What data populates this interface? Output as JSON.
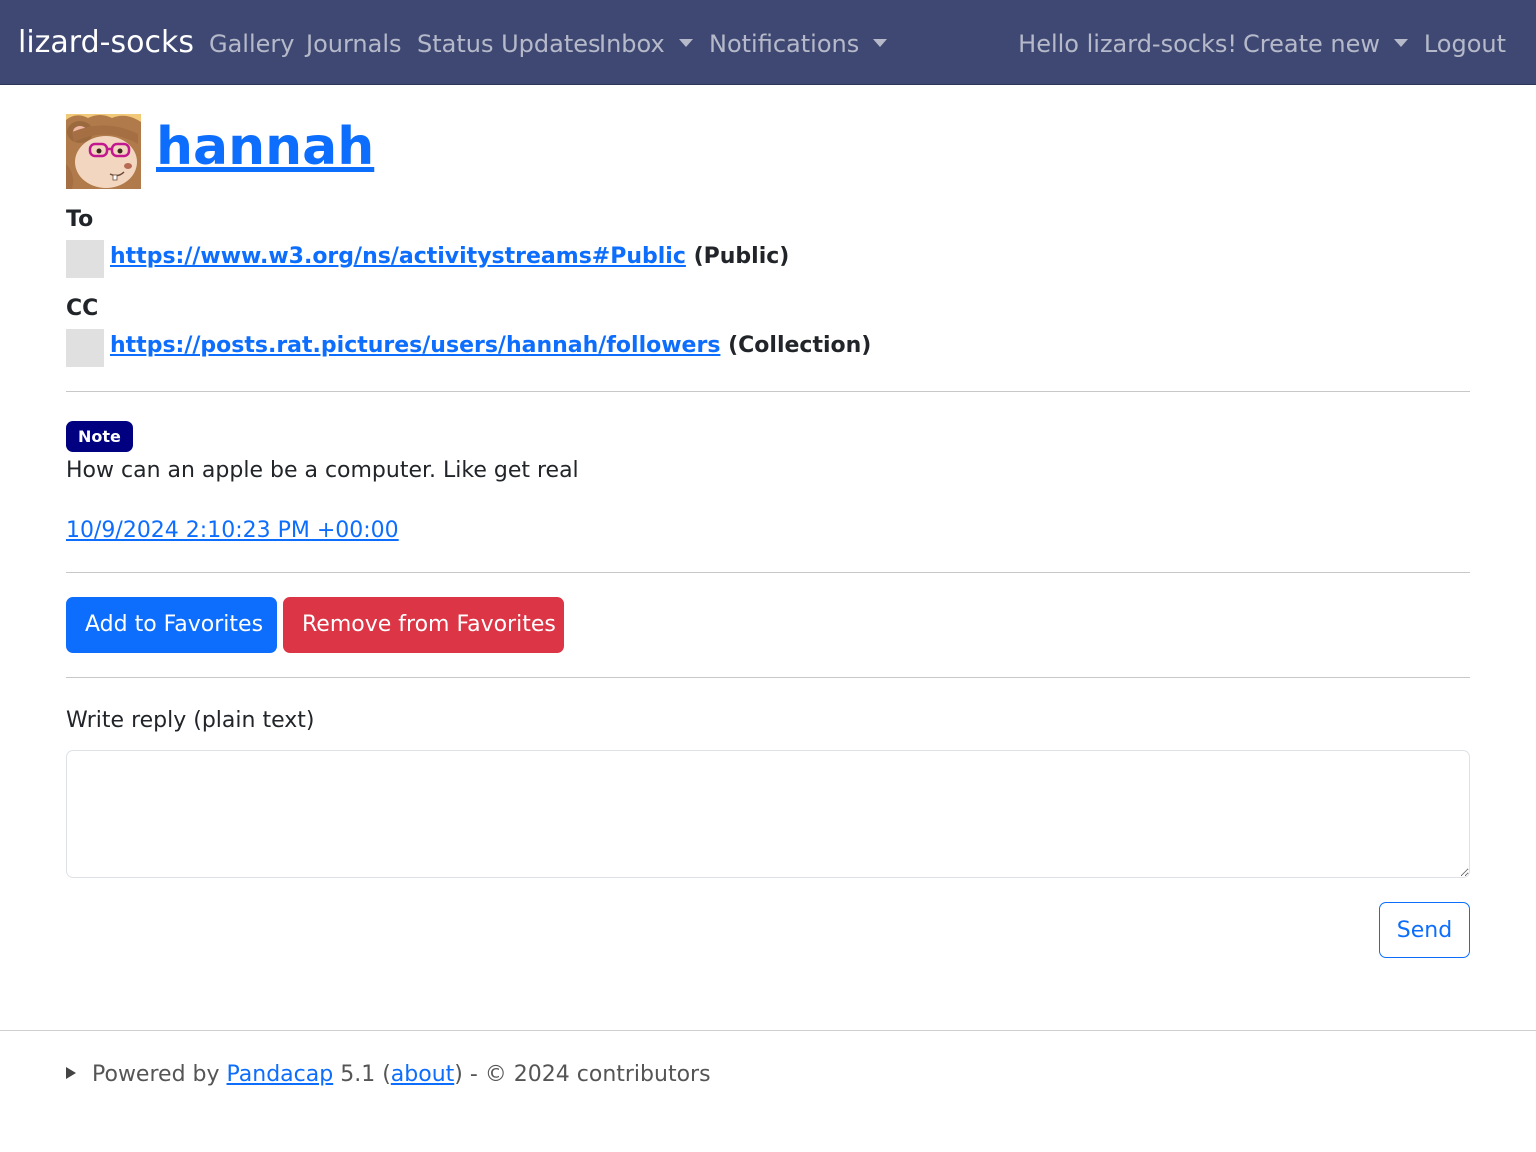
{
  "navbar": {
    "brand": "lizard-socks",
    "links": {
      "gallery": "Gallery",
      "journals": "Journals",
      "status_updates": "Status Updates",
      "inbox": "Inbox",
      "notifications": "Notifications"
    },
    "greeting": "Hello lizard-socks!",
    "create_new": "Create new",
    "logout": "Logout",
    "dropdown_icon": "caret-down-icon",
    "colors": {
      "background": "#3e4872",
      "text": "#ffffff",
      "muted_text": "rgba(255,255,255,0.62)"
    }
  },
  "post": {
    "author": {
      "name": "hannah",
      "avatar_icon": "rat-avatar-icon"
    },
    "to": {
      "label": "To",
      "recipients": [
        {
          "url": "https://www.w3.org/ns/activitystreams#Public",
          "kind": "(Public)"
        }
      ]
    },
    "cc": {
      "label": "CC",
      "recipients": [
        {
          "url": "https://posts.rat.pictures/users/hannah/followers",
          "kind": "(Collection)"
        }
      ]
    },
    "type_badge": "Note",
    "content": "How can an apple be a computer. Like get real",
    "timestamp": "10/9/2024 2:10:23 PM +00:00"
  },
  "actions": {
    "add_favorite": "Add to Favorites",
    "remove_favorite": "Remove from Favorites"
  },
  "reply": {
    "label": "Write reply (plain text)",
    "value": "",
    "send": "Send"
  },
  "footer": {
    "prefix": "Powered by",
    "product": "Pandacap",
    "version": "5.1",
    "about": "about",
    "copyright": "- © 2024 contributors",
    "disclosure_icon": "triangle-right-icon"
  },
  "colors": {
    "primary": "#0d6efd",
    "danger": "#dc3545",
    "note_badge": "#000080",
    "placeholder_icon": "#e0e0e0"
  }
}
